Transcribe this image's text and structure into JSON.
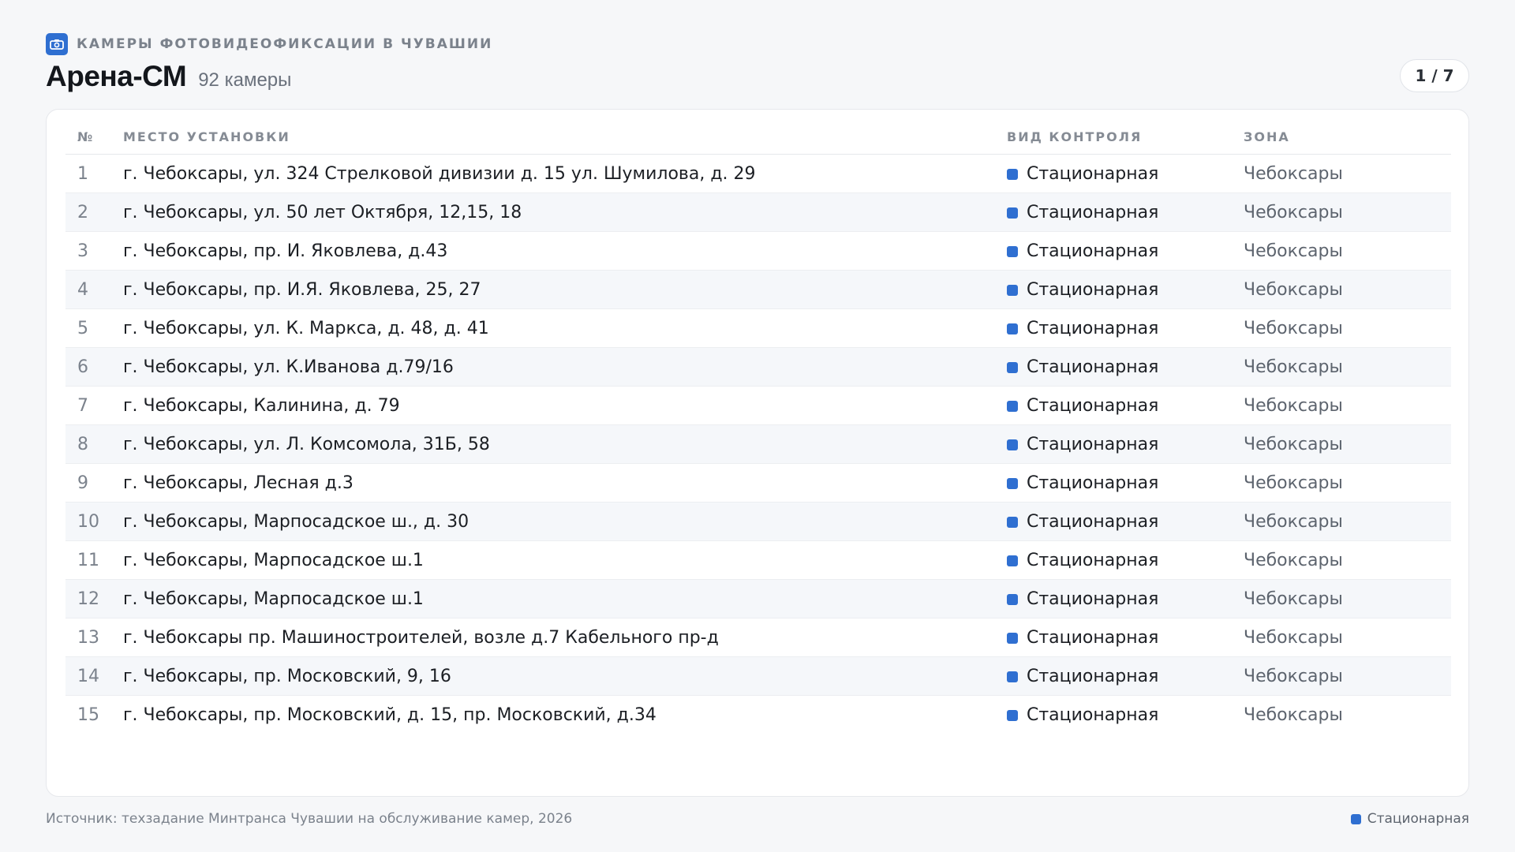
{
  "header": {
    "kicker": "КАМЕРЫ ФОТОВИДЕОФИКСАЦИИ В ЧУВАШИИ",
    "kicker_icon": "camera-icon",
    "title": "Арена-СМ",
    "count": "92 камеры",
    "pager": "1 / 7"
  },
  "colors": {
    "accent": "#2f6fd1"
  },
  "table": {
    "columns": {
      "num": "№",
      "place": "МЕСТО УСТАНОВКИ",
      "type": "ВИД КОНТРОЛЯ",
      "zone": "ЗОНА"
    },
    "rows": [
      {
        "num": "1",
        "place": "г. Чебоксары, ул. 324 Стрелковой дивизии д. 15 ул. Шумилова, д. 29",
        "type": "Стационарная",
        "zone": "Чебоксары"
      },
      {
        "num": "2",
        "place": "г. Чебоксары, ул. 50 лет Октября, 12,15, 18",
        "type": "Стационарная",
        "zone": "Чебоксары"
      },
      {
        "num": "3",
        "place": "г. Чебоксары, пр. И. Яковлева, д.43",
        "type": "Стационарная",
        "zone": "Чебоксары"
      },
      {
        "num": "4",
        "place": "г. Чебоксары, пр. И.Я. Яковлева, 25, 27",
        "type": "Стационарная",
        "zone": "Чебоксары"
      },
      {
        "num": "5",
        "place": "г. Чебоксары, ул. К. Маркса, д. 48, д. 41",
        "type": "Стационарная",
        "zone": "Чебоксары"
      },
      {
        "num": "6",
        "place": "г. Чебоксары, ул. К.Иванова д.79/16",
        "type": "Стационарная",
        "zone": "Чебоксары"
      },
      {
        "num": "7",
        "place": "г. Чебоксары, Калинина, д. 79",
        "type": "Стационарная",
        "zone": "Чебоксары"
      },
      {
        "num": "8",
        "place": "г. Чебоксары, ул. Л. Комсомола, 31Б, 58",
        "type": "Стационарная",
        "zone": "Чебоксары"
      },
      {
        "num": "9",
        "place": "г. Чебоксары, Лесная д.3",
        "type": "Стационарная",
        "zone": "Чебоксары"
      },
      {
        "num": "10",
        "place": "г. Чебоксары, Марпосадское ш., д. 30",
        "type": "Стационарная",
        "zone": "Чебоксары"
      },
      {
        "num": "11",
        "place": "г. Чебоксары, Марпосадское ш.1",
        "type": "Стационарная",
        "zone": "Чебоксары"
      },
      {
        "num": "12",
        "place": "г. Чебоксары, Марпосадское ш.1",
        "type": "Стационарная",
        "zone": "Чебоксары"
      },
      {
        "num": "13",
        "place": "г. Чебоксары пр. Машиностроителей, возле д.7 Кабельного пр-д",
        "type": "Стационарная",
        "zone": "Чебоксары"
      },
      {
        "num": "14",
        "place": "г. Чебоксары, пр. Московский, 9, 16",
        "type": "Стационарная",
        "zone": "Чебоксары"
      },
      {
        "num": "15",
        "place": "г. Чебоксары, пр. Московский, д. 15, пр. Московский, д.34",
        "type": "Стационарная",
        "zone": "Чебоксары"
      }
    ]
  },
  "footer": {
    "source": "Источник: техзадание Минтранса Чувашии на обслуживание камер, 2026",
    "legend_label": "Стационарная"
  }
}
